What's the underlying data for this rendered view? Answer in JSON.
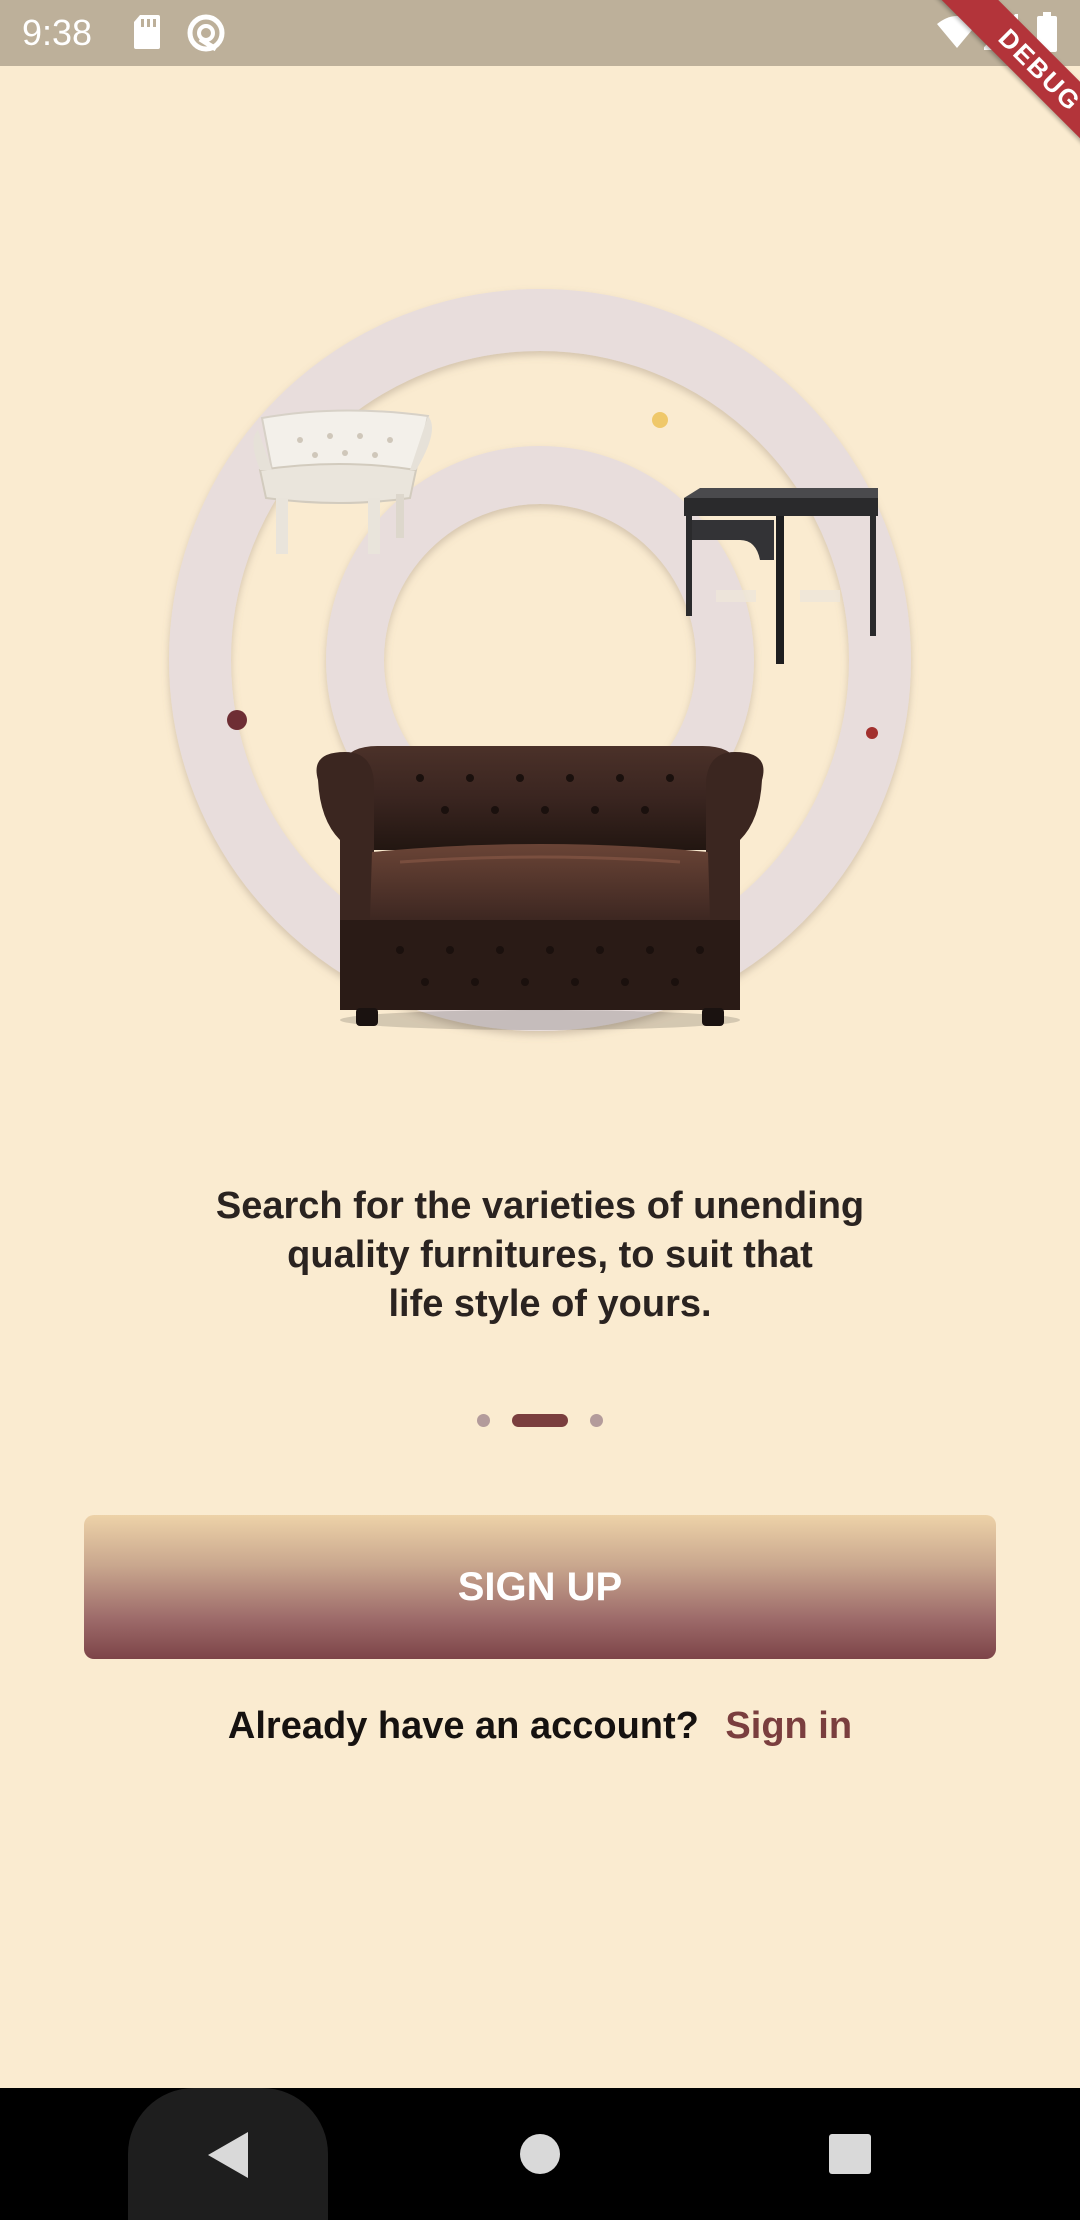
{
  "status_bar": {
    "time": "9:38",
    "icons": [
      "sd-card-icon",
      "sync-icon",
      "wifi-icon",
      "signal-icon",
      "battery-icon"
    ],
    "color": "#BDB09A"
  },
  "debug_banner": {
    "label": "DEBUG"
  },
  "onboarding": {
    "illustration_items": [
      "armchair-image",
      "desk-image",
      "chesterfield-sofa-image"
    ],
    "tagline_lines": [
      "Search for the varieties of unending",
      "quality furnitures, to suit that",
      "life style of yours."
    ],
    "page_count": 3,
    "active_page": 2
  },
  "actions": {
    "signup_label": "SIGN UP",
    "signin_question": "Already have an account?",
    "signin_link": "Sign in"
  },
  "nav_bar": {
    "buttons": [
      "back-icon",
      "home-icon",
      "recents-icon"
    ]
  },
  "colors": {
    "background": "#FAEBD0",
    "accent": "#7A3E3E",
    "ring": "#E8DDDC",
    "button_top": "#EDD2A8",
    "button_bottom": "#7D4448"
  }
}
